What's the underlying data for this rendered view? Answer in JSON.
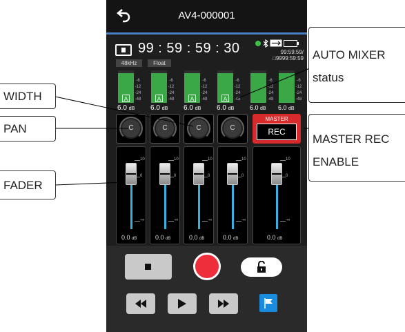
{
  "titlebar": {
    "title": "AV4-000001",
    "back_icon": "back-arrow-icon"
  },
  "status": {
    "timecode": "99 : 59 : 59 : 30",
    "sample_rate": "48kHz",
    "bit_depth": "Float",
    "remaining_time": "99:59:59/",
    "total_time": "□9999:59:59"
  },
  "meters": {
    "scale": [
      "-6",
      "-12",
      "-24",
      "-48"
    ],
    "auto_mixer_badge": "A",
    "channels": [
      {
        "level": 0.92,
        "db": "6.0",
        "unit": "dB"
      },
      {
        "level": 0.92,
        "db": "6.0",
        "unit": "dB"
      },
      {
        "level": 0.92,
        "db": "6.0",
        "unit": "dB"
      },
      {
        "level": 0.92,
        "db": "6.0",
        "unit": "dB"
      },
      {
        "level": 0.92,
        "db": "6.0",
        "unit": "dB"
      },
      {
        "level": 0.92,
        "db": "6.0",
        "unit": "dB"
      }
    ]
  },
  "pan": {
    "knob_label": "C"
  },
  "master": {
    "label": "MASTER",
    "rec": "REC"
  },
  "fader": {
    "scale_top": "10",
    "scale_mid": "0",
    "scale_bottom": "-∞",
    "values": [
      "0.0",
      "0.0",
      "0.0",
      "0.0",
      "0.0"
    ],
    "unit": "dB"
  },
  "callouts": {
    "auto_mixer": [
      "AUTO MIXER",
      "status"
    ],
    "width": "WIDTH",
    "pan": "PAN",
    "master_rec": [
      "MASTER REC",
      "ENABLE"
    ],
    "fader": "FADER"
  },
  "colors": {
    "accent_blue": "#4a7fc4",
    "meter_green": "#3aa846",
    "rec_red": "#ee2e3b",
    "fader_blue": "#3bb0de"
  }
}
